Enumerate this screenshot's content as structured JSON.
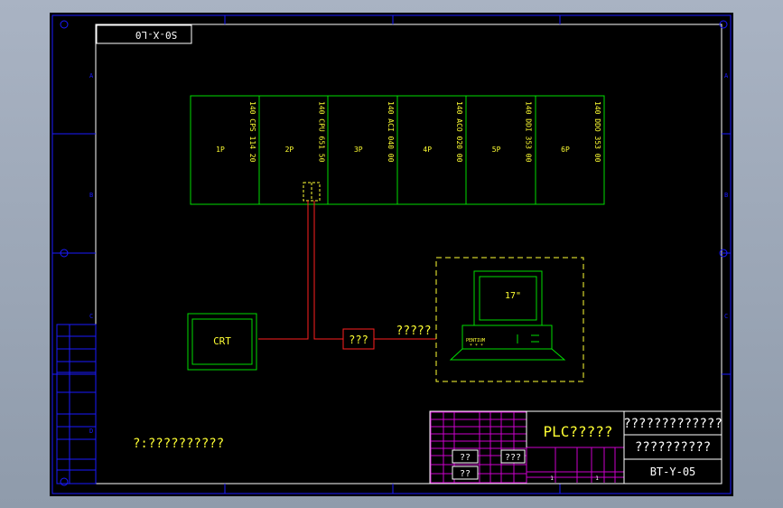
{
  "drawing": {
    "stamp": "S0-X-L0",
    "modules": [
      {
        "slot": "1P",
        "model": "140 CPS 114 20"
      },
      {
        "slot": "2P",
        "model": "140 CPU 651 50"
      },
      {
        "slot": "3P",
        "model": "140 ACI 040 00"
      },
      {
        "slot": "4P",
        "model": "140 ACO 020 00"
      },
      {
        "slot": "5P",
        "model": "140 DDI 353 00"
      },
      {
        "slot": "6P",
        "model": "140 DDO 353 00"
      }
    ],
    "crt_label": "CRT",
    "converter_label": "???",
    "link_label": "?????",
    "monitor_label": "17\"",
    "computer_brand": "PENTIUM",
    "computer_dots": "* * *",
    "note": "?:??????????",
    "border_letters": [
      "A",
      "B",
      "C",
      "D"
    ]
  },
  "title_block": {
    "title": "PLC?????",
    "project_line1": "?????????????",
    "project_line2": "??????????",
    "drawing_no": "BT-Y-05",
    "cell_a": "??",
    "cell_b": "???",
    "cell_c": "??",
    "cell_d": "1",
    "cell_e": "1"
  },
  "colors": {
    "background": "#000000",
    "border": "#1a1aff",
    "module": "#00dd00",
    "wire": "#ff2020",
    "text_yellow": "#ffff33",
    "text_white": "#ffffff",
    "title_grid": "#cc00cc"
  }
}
